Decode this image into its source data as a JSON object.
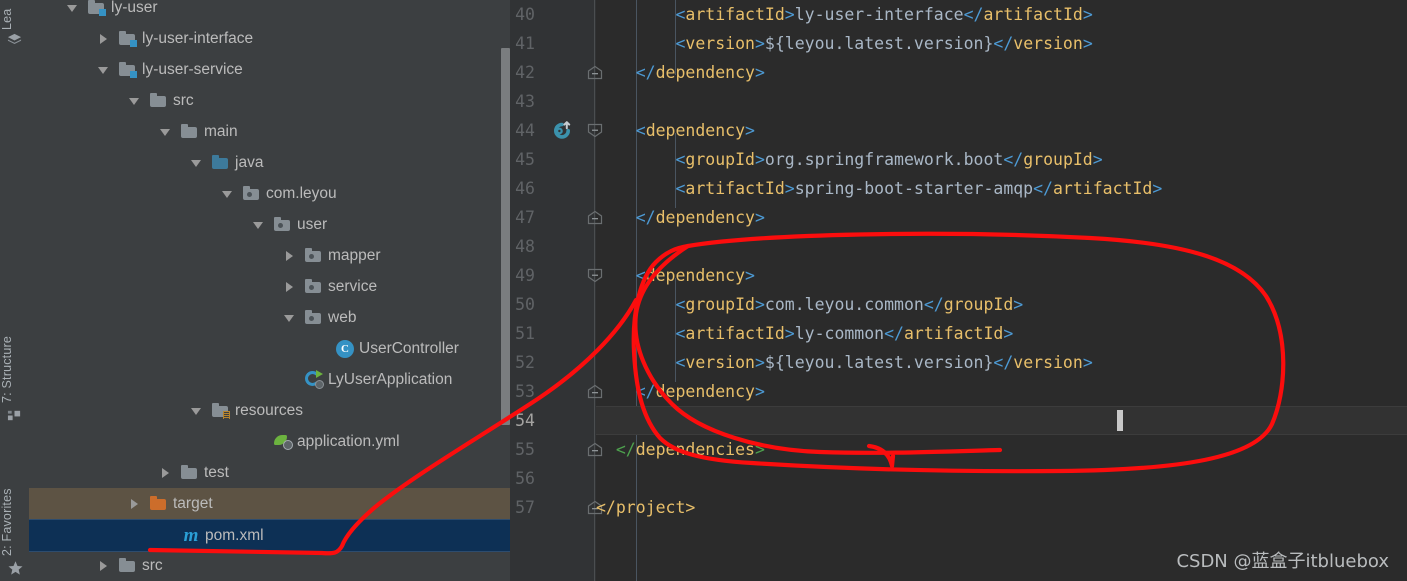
{
  "toolstrip": {
    "tabs": [
      {
        "label": "Lea",
        "icon": "learn-icon"
      },
      {
        "label": "7: Structure",
        "icon": "structure-icon"
      },
      {
        "label": "2: Favorites",
        "icon": "star-icon"
      }
    ]
  },
  "project_tree": {
    "items": [
      {
        "label": "ly-user",
        "indent": 0,
        "arrow": "down",
        "icon": "module-folder-icon"
      },
      {
        "label": "ly-user-interface",
        "indent": 1,
        "arrow": "right",
        "icon": "module-folder-icon"
      },
      {
        "label": "ly-user-service",
        "indent": 1,
        "arrow": "down",
        "icon": "module-folder-icon"
      },
      {
        "label": "src",
        "indent": 2,
        "arrow": "down",
        "icon": "folder-icon"
      },
      {
        "label": "main",
        "indent": 3,
        "arrow": "down",
        "icon": "folder-icon"
      },
      {
        "label": "java",
        "indent": 4,
        "arrow": "down",
        "icon": "source-folder-icon"
      },
      {
        "label": "com.leyou",
        "indent": 5,
        "arrow": "down",
        "icon": "package-icon"
      },
      {
        "label": "user",
        "indent": 6,
        "arrow": "down",
        "icon": "package-icon"
      },
      {
        "label": "mapper",
        "indent": 7,
        "arrow": "right",
        "icon": "package-icon"
      },
      {
        "label": "service",
        "indent": 7,
        "arrow": "right",
        "icon": "package-icon"
      },
      {
        "label": "web",
        "indent": 7,
        "arrow": "down",
        "icon": "package-icon"
      },
      {
        "label": "UserController",
        "indent": 8,
        "arrow": "none",
        "icon": "java-class-icon"
      },
      {
        "label": "LyUserApplication",
        "indent": 7,
        "arrow": "none",
        "icon": "spring-boot-icon"
      },
      {
        "label": "resources",
        "indent": 4,
        "arrow": "down",
        "icon": "resources-folder-icon"
      },
      {
        "label": "application.yml",
        "indent": 6,
        "arrow": "none",
        "icon": "spring-yaml-icon"
      },
      {
        "label": "test",
        "indent": 3,
        "arrow": "right",
        "icon": "folder-icon"
      },
      {
        "label": "target",
        "indent": 2,
        "arrow": "right",
        "icon": "excluded-folder-icon"
      },
      {
        "label": "pom.xml",
        "indent": 3,
        "arrow": "none",
        "icon": "maven-file-icon"
      },
      {
        "label": "src",
        "indent": 1,
        "arrow": "right",
        "icon": "folder-icon"
      }
    ],
    "highlighted_row": "target",
    "selected_row": "pom.xml"
  },
  "editor": {
    "first_line_number": 40,
    "current_line_number": 54,
    "gutter_icon": "maven-reimport-icon",
    "gutter_icon_line": 44,
    "fold_markers": [
      {
        "line": 42,
        "type": "fold-end"
      },
      {
        "line": 44,
        "type": "fold-start"
      },
      {
        "line": 47,
        "type": "fold-end"
      },
      {
        "line": 49,
        "type": "fold-start"
      },
      {
        "line": 53,
        "type": "fold-end"
      },
      {
        "line": 55,
        "type": "fold-end"
      },
      {
        "line": 57,
        "type": "fold-end"
      }
    ],
    "lines": [
      {
        "n": 40,
        "tokens": [
          {
            "t": "        ",
            "c": "tx"
          },
          {
            "t": "<",
            "c": "br"
          },
          {
            "t": "artifactId",
            "c": "tg"
          },
          {
            "t": ">",
            "c": "br"
          },
          {
            "t": "ly-user-interface",
            "c": "tx"
          },
          {
            "t": "</",
            "c": "br"
          },
          {
            "t": "artifactId",
            "c": "tg"
          },
          {
            "t": ">",
            "c": "br"
          }
        ]
      },
      {
        "n": 41,
        "tokens": [
          {
            "t": "        ",
            "c": "tx"
          },
          {
            "t": "<",
            "c": "br"
          },
          {
            "t": "version",
            "c": "tg"
          },
          {
            "t": ">",
            "c": "br"
          },
          {
            "t": "${leyou.latest.version}",
            "c": "tx"
          },
          {
            "t": "</",
            "c": "br"
          },
          {
            "t": "version",
            "c": "tg"
          },
          {
            "t": ">",
            "c": "br"
          }
        ]
      },
      {
        "n": 42,
        "tokens": [
          {
            "t": "    ",
            "c": "tx"
          },
          {
            "t": "</",
            "c": "br"
          },
          {
            "t": "dependency",
            "c": "tg"
          },
          {
            "t": ">",
            "c": "br"
          }
        ]
      },
      {
        "n": 43,
        "tokens": []
      },
      {
        "n": 44,
        "tokens": [
          {
            "t": "    ",
            "c": "tx"
          },
          {
            "t": "<",
            "c": "br"
          },
          {
            "t": "dependency",
            "c": "tg"
          },
          {
            "t": ">",
            "c": "br"
          }
        ]
      },
      {
        "n": 45,
        "tokens": [
          {
            "t": "        ",
            "c": "tx"
          },
          {
            "t": "<",
            "c": "br"
          },
          {
            "t": "groupId",
            "c": "tg"
          },
          {
            "t": ">",
            "c": "br"
          },
          {
            "t": "org.springframework.boot",
            "c": "tx"
          },
          {
            "t": "</",
            "c": "br"
          },
          {
            "t": "groupId",
            "c": "tg"
          },
          {
            "t": ">",
            "c": "br"
          }
        ]
      },
      {
        "n": 46,
        "tokens": [
          {
            "t": "        ",
            "c": "tx"
          },
          {
            "t": "<",
            "c": "br"
          },
          {
            "t": "artifactId",
            "c": "tg"
          },
          {
            "t": ">",
            "c": "br"
          },
          {
            "t": "spring-boot-starter-amqp",
            "c": "tx"
          },
          {
            "t": "</",
            "c": "br"
          },
          {
            "t": "artifactId",
            "c": "tg"
          },
          {
            "t": ">",
            "c": "br"
          }
        ]
      },
      {
        "n": 47,
        "tokens": [
          {
            "t": "    ",
            "c": "tx"
          },
          {
            "t": "</",
            "c": "br"
          },
          {
            "t": "dependency",
            "c": "tg"
          },
          {
            "t": ">",
            "c": "br"
          }
        ]
      },
      {
        "n": 48,
        "tokens": []
      },
      {
        "n": 49,
        "tokens": [
          {
            "t": "    ",
            "c": "tx"
          },
          {
            "t": "<",
            "c": "br"
          },
          {
            "t": "dependency",
            "c": "tg"
          },
          {
            "t": ">",
            "c": "br"
          }
        ]
      },
      {
        "n": 50,
        "tokens": [
          {
            "t": "        ",
            "c": "tx"
          },
          {
            "t": "<",
            "c": "br"
          },
          {
            "t": "groupId",
            "c": "tg"
          },
          {
            "t": ">",
            "c": "br"
          },
          {
            "t": "com.leyou.common",
            "c": "tx"
          },
          {
            "t": "</",
            "c": "br"
          },
          {
            "t": "groupId",
            "c": "tg"
          },
          {
            "t": ">",
            "c": "br"
          }
        ]
      },
      {
        "n": 51,
        "tokens": [
          {
            "t": "        ",
            "c": "tx"
          },
          {
            "t": "<",
            "c": "br"
          },
          {
            "t": "artifactId",
            "c": "tg"
          },
          {
            "t": ">",
            "c": "br"
          },
          {
            "t": "ly-common",
            "c": "tx"
          },
          {
            "t": "</",
            "c": "br"
          },
          {
            "t": "artifactId",
            "c": "tg"
          },
          {
            "t": ">",
            "c": "br"
          }
        ]
      },
      {
        "n": 52,
        "tokens": [
          {
            "t": "        ",
            "c": "tx"
          },
          {
            "t": "<",
            "c": "br"
          },
          {
            "t": "version",
            "c": "tg"
          },
          {
            "t": ">",
            "c": "br"
          },
          {
            "t": "${leyou.latest.version}",
            "c": "tx"
          },
          {
            "t": "</",
            "c": "br"
          },
          {
            "t": "version",
            "c": "tg"
          },
          {
            "t": ">",
            "c": "br"
          }
        ]
      },
      {
        "n": 53,
        "tokens": [
          {
            "t": "    ",
            "c": "tx"
          },
          {
            "t": "</",
            "c": "br"
          },
          {
            "t": "dependency",
            "c": "tg"
          },
          {
            "t": ">",
            "c": "br"
          }
        ]
      },
      {
        "n": 54,
        "tokens": []
      },
      {
        "n": 55,
        "tokens": [
          {
            "t": "  ",
            "c": "tx"
          },
          {
            "t": "</",
            "c": "brg"
          },
          {
            "t": "dependencies",
            "c": "tg"
          },
          {
            "t": ">",
            "c": "brg"
          }
        ]
      },
      {
        "n": 56,
        "tokens": []
      },
      {
        "n": 57,
        "tokens": [
          {
            "t": "</",
            "c": "tg"
          },
          {
            "t": "project",
            "c": "tg"
          },
          {
            "t": ">",
            "c": "tg"
          }
        ]
      }
    ]
  },
  "annotation": {
    "color": "#fb0d0d",
    "shape": "hand-drawn-circle-with-pointer-to-pom-xml"
  },
  "watermark": {
    "text": "CSDN @蓝盒子itbluebox"
  },
  "colors": {
    "panel_bg": "#3c3f41",
    "editor_bg": "#2b2b2b",
    "gutter_bg": "#313335",
    "selection_blue": "#0d3055",
    "highlight_olive": "#5d5344",
    "accent_blue": "#3592c4",
    "green_text": "#6a8759",
    "tag_orange": "#e8bf6a",
    "annotation_red": "#fb0d0d"
  }
}
